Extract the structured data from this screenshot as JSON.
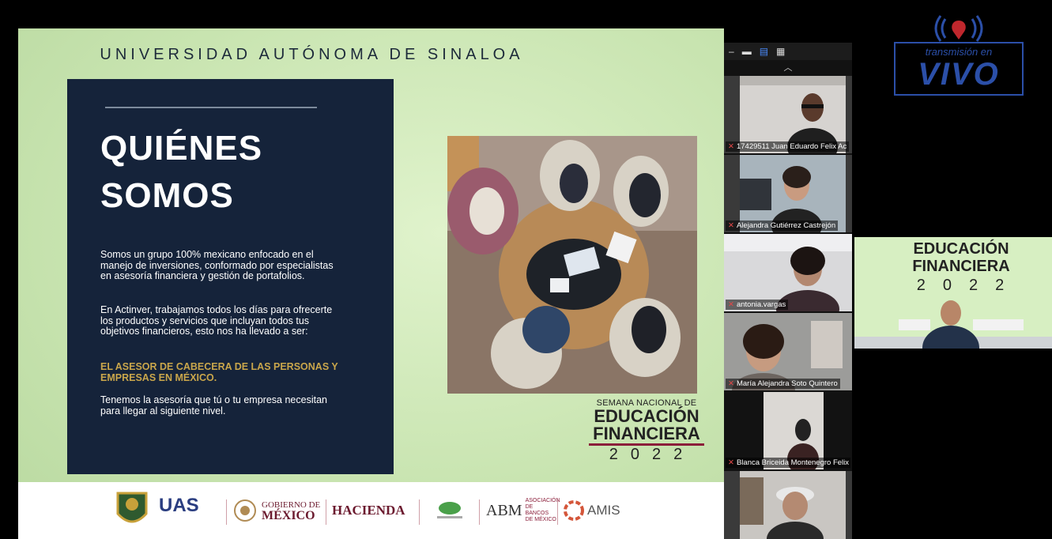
{
  "slide": {
    "university_title": "UNIVERSIDAD AUTÓNOMA DE SINALOA",
    "heading_line1": "QUIÉNES",
    "heading_line2": "SOMOS",
    "paragraph1": "Somos un grupo 100% mexicano enfocado en el manejo de inversiones, conformado por especialistas en asesoría financiera y gestión de portafolios.",
    "paragraph2": "En Actinver, trabajamos todos los días para ofrecerte los productos y servicios que incluyan todos tus objetivos financieros, esto nos ha llevado a ser:",
    "highlight": "EL ASESOR DE CABECERA DE LAS PERSONAS Y EMPRESAS EN MÉXICO.",
    "paragraph3": "Tenemos la asesoría que tú o tu empresa necesitan para llegar al siguiente nivel.",
    "event_line1": "SEMANA NACIONAL DE",
    "event_line2": "EDUCACIÓN",
    "event_line3": "FINANCIERA",
    "event_year": "2022",
    "logos": {
      "uas": "UAS",
      "gobierno_line1": "GOBIERNO DE",
      "gobierno_line2": "MÉXICO",
      "hacienda": "HACIENDA",
      "abm_short": "ABM",
      "abm_full": "ASOCIACIÓN DE BANCOS DE MÉXICO",
      "amis": "AMIS"
    }
  },
  "participants": [
    {
      "name": "17429511 Juan Eduardo Felix Ac"
    },
    {
      "name": "Alejandra Gutiérrez Castrejón"
    },
    {
      "name": "antonia.vargas"
    },
    {
      "name": "María Alejandra Soto Quintero"
    },
    {
      "name": "Blanca Briceida Montenegro Felix"
    },
    {
      "name": ""
    }
  ],
  "live_badge": {
    "sub": "transmisión en",
    "big": "VIVO"
  },
  "speaker_tile": {
    "line1": "EDUCACIÓN",
    "line2": "FINANCIERA",
    "year": "2022"
  }
}
